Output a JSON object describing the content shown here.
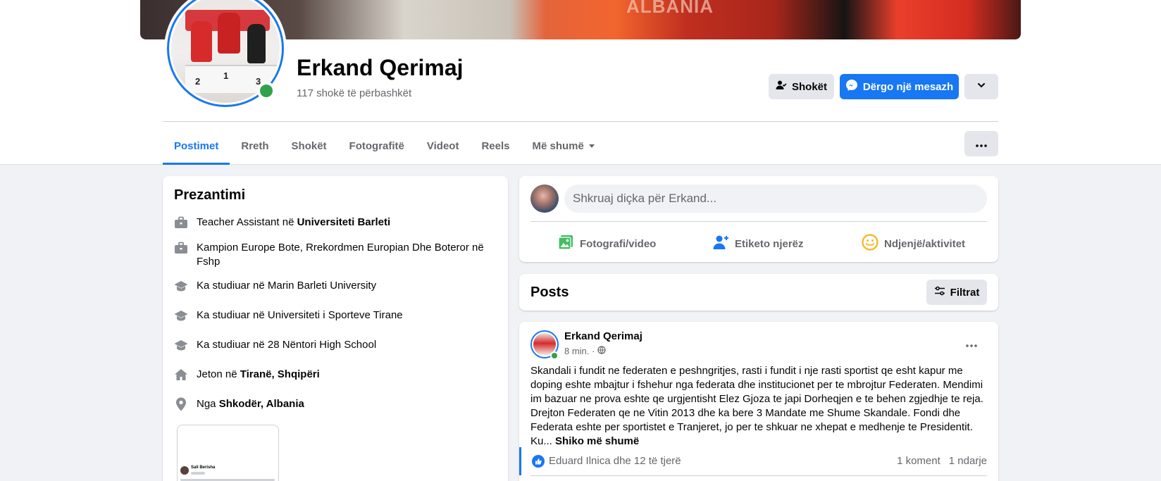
{
  "cover": {
    "text": "ALBANIA"
  },
  "profile": {
    "name": "Erkand Qerimaj",
    "mutual_friends": "117 shokë të përbashkët",
    "podium_numbers": [
      "2",
      "1",
      "3"
    ]
  },
  "actions": {
    "friends_label": "Shokët",
    "message_label": "Dërgo një mesazh"
  },
  "tabs": [
    {
      "label": "Postimet",
      "active": true
    },
    {
      "label": "Rreth"
    },
    {
      "label": "Shokët"
    },
    {
      "label": "Fotografitë"
    },
    {
      "label": "Videot"
    },
    {
      "label": "Reels"
    },
    {
      "label": "Më shumë"
    }
  ],
  "intro": {
    "title": "Prezantimi",
    "items": [
      {
        "icon": "briefcase-icon",
        "text": "Teacher Assistant në ",
        "bold": "Universiteti Barleti"
      },
      {
        "icon": "briefcase-icon",
        "text": "Kampion Europe Bote, Rrekordmen Europian Dhe Boteror në Fshp",
        "bold": ""
      },
      {
        "icon": "graduation-cap-icon",
        "text": "Ka studiuar në Marin Barleti University",
        "bold": ""
      },
      {
        "icon": "graduation-cap-icon",
        "text": "Ka studiuar në Universiteti i Sporteve Tirane",
        "bold": ""
      },
      {
        "icon": "graduation-cap-icon",
        "text": "Ka studiuar në 28 Nëntori High School",
        "bold": ""
      },
      {
        "icon": "home-icon",
        "text": "Jeton në ",
        "bold": "Tiranë, Shqipëri"
      },
      {
        "icon": "location-pin-icon",
        "text": "Nga ",
        "bold": "Shkodër, Albania"
      }
    ],
    "featured_name": "Sali Berisha"
  },
  "composer": {
    "placeholder": "Shkruaj diçka për Erkand...",
    "photo_video": "Fotografi/video",
    "tag_people": "Etiketo njerëz",
    "feeling": "Ndjenjë/aktivitet"
  },
  "posts_header": {
    "title": "Posts",
    "filter_label": "Filtrat"
  },
  "post": {
    "author": "Erkand Qerimaj",
    "time": "8 min. ·",
    "text": "Skandali i fundit ne federaten e peshngritjes, rasti i fundit i nje rasti sportist qe esht kapur me doping eshte mbajtur i fshehur nga federata dhe institucionet per te mbrojtur Federaten. Mendimi im bazuar ne prova eshte qe urgjentisht Elez Gjoza te japi Dorheqjen e te behen zgjedhje te reja. Drejton Federaten qe ne Vitin 2013 dhe ka bere 3 Mandate me Shume Skandale. Fondi dhe Federata eshte per sportistet e Tranjeret, jo per te shkuar ne xhepat e medhenje te Presidentit. Ku... ",
    "see_more": "Shiko më shumë",
    "reactors": "Eduard Ilnica dhe 12 të tjerë",
    "comments": "1 koment",
    "shares": "1 ndarje"
  },
  "colors": {
    "accent": "#1877f2",
    "online": "#31a24c",
    "photo_green": "#45bd62",
    "tag_blue": "#1877f2",
    "feeling_yellow": "#f7b928"
  }
}
